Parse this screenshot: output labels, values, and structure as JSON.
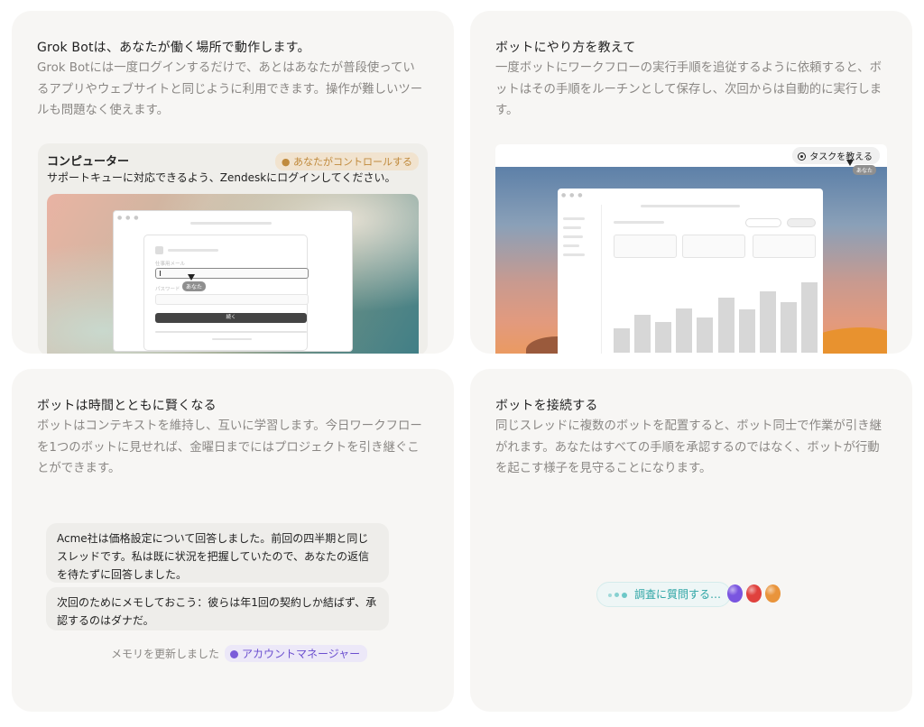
{
  "cards": [
    {
      "title": "Grok Botは、あなたが働く場所で動作します。",
      "description": "Grok Botには一度ログインするだけで、あとはあなたが普段使っているアプリやウェブサイトと同じように利用できます。操作が難しいツールも問題なく使えます。",
      "mock": {
        "panel_title": "コンピューター",
        "control_pill": "● あなたがコントロールする",
        "message": "サポートキューに対応できるよう、Zendeskにログインしてください。",
        "email_label": "仕事用メール",
        "password_label": "パスワード",
        "continue_button": "続く",
        "cursor_tag": "あなた"
      }
    },
    {
      "title": "ボットにやり方を教えて",
      "description": "一度ボットにワークフローの実行手順を追従するように依頼すると、ボットはその手順をルーチンとして保存し、次回からは自動的に実行します。",
      "mock": {
        "teach_button": "タスクを教える",
        "cursor_tag": "あなた",
        "bars": [
          0.3,
          0.47,
          0.38,
          0.55,
          0.43,
          0.68,
          0.53,
          0.76,
          0.62,
          0.87
        ]
      }
    },
    {
      "title": "ボットは時間とともに賢くなる",
      "description": "ボットはコンテキストを維持し、互いに学習します。今日ワークフローを1つのボットに見せれば、金曜日までにはプロジェクトを引き継ぐことができます。",
      "messages": [
        "Acme社は価格設定について回答しました。前回の四半期と同じスレッドです。私は既に状況を把握していたので、あなたの返信を待たずに回答しました。",
        "次回のためにメモしておこう：彼らは年1回の契約しか結ばず、承認するのはダナだ。"
      ],
      "memory_note": "メモリを更新しました",
      "memory_tag": "アカウントマネージャー"
    },
    {
      "title": "ボットを接続する",
      "description": "同じスレッドに複数のボットを配置すると、ボット同士で作業が引き継がれます。あなたはすべての手順を承認するのではなく、ボットが行動を起こす様子を見守ることになります。",
      "ask_label": "調査に質問する…",
      "bot_colors": [
        "#7a55e0",
        "#e0413d",
        "#e9943b"
      ]
    }
  ]
}
